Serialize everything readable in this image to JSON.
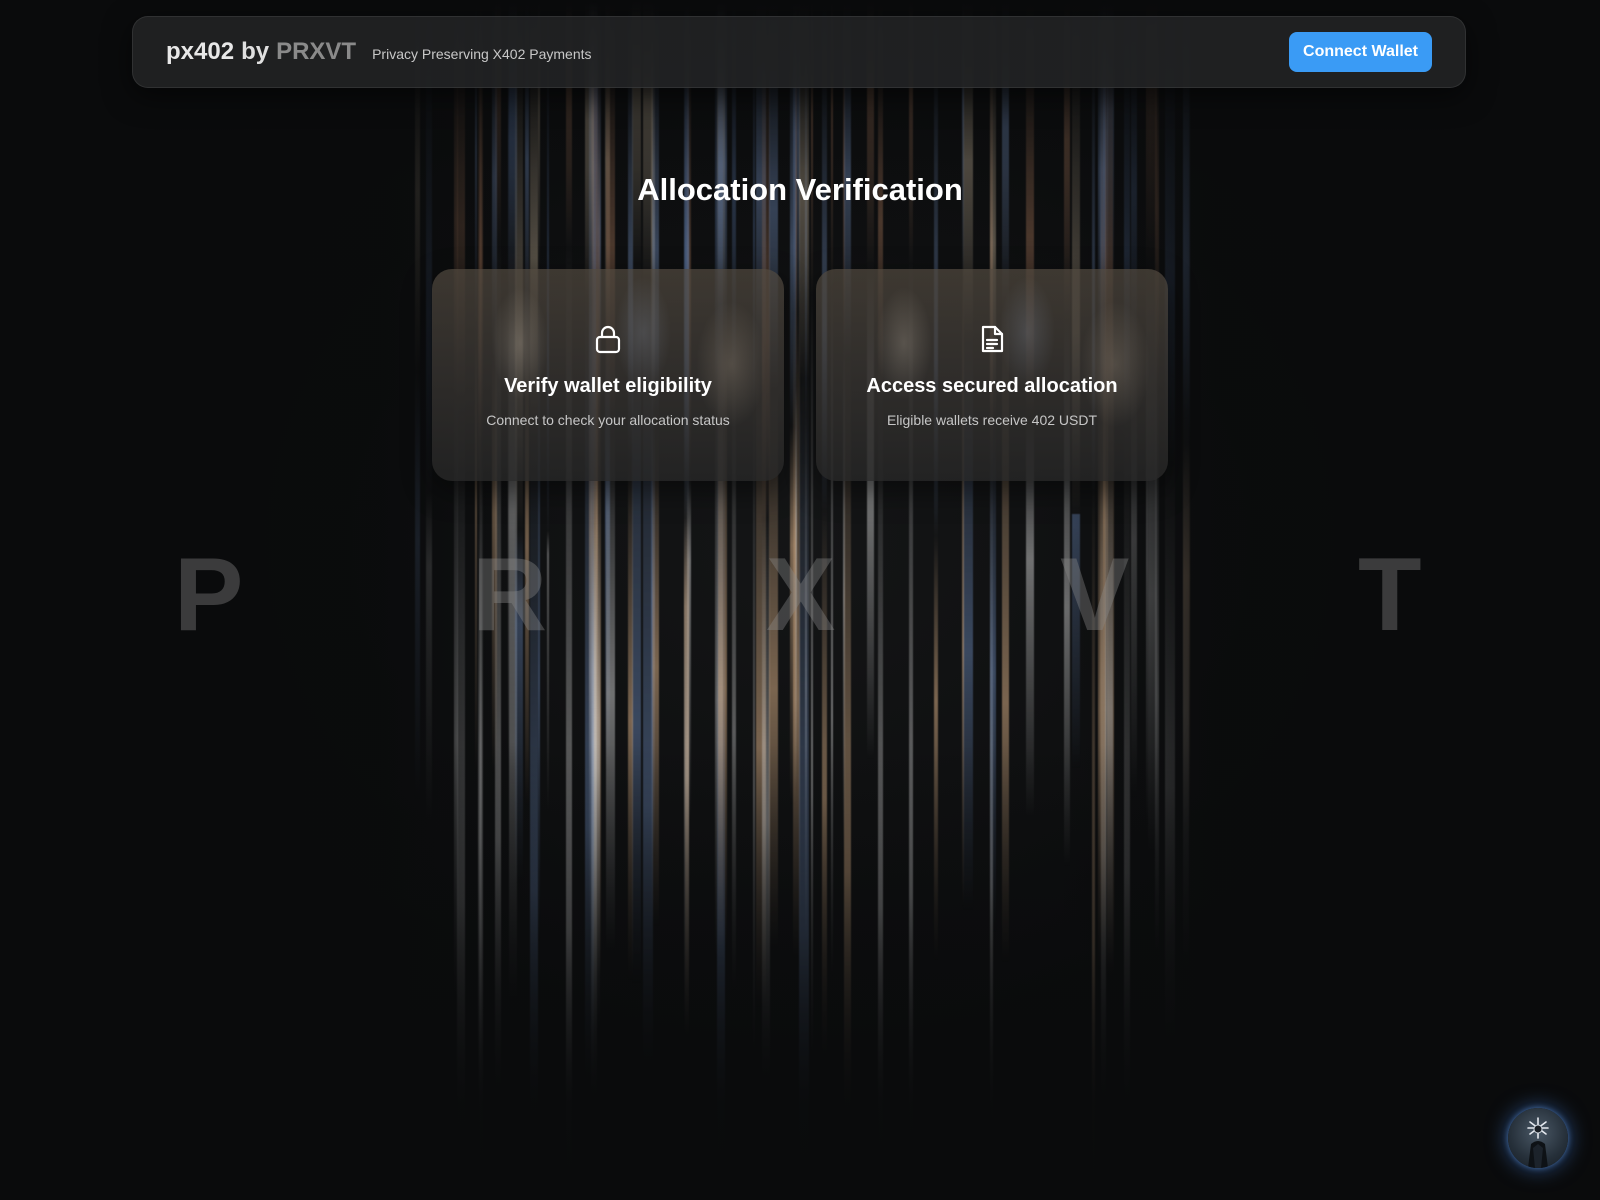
{
  "header": {
    "brand_name": "px402",
    "brand_by": "by",
    "brand_org": "PRXVT",
    "tagline": "Privacy Preserving X402 Payments",
    "connect_label": "Connect Wallet"
  },
  "main": {
    "title": "Allocation Verification",
    "cards": [
      {
        "icon": "lock-icon",
        "title": "Verify wallet eligibility",
        "subtitle": "Connect to check your allocation status"
      },
      {
        "icon": "document-icon",
        "title": "Access secured allocation",
        "subtitle": "Eligible wallets receive 402 USDT"
      }
    ]
  },
  "background_letters": [
    "P",
    "R",
    "X",
    "V",
    "T"
  ],
  "colors": {
    "accent": "#3a9bf5",
    "background": "#0a0b0c",
    "header_bg": "#222324"
  },
  "fab": {
    "icon": "avatar-icon"
  }
}
